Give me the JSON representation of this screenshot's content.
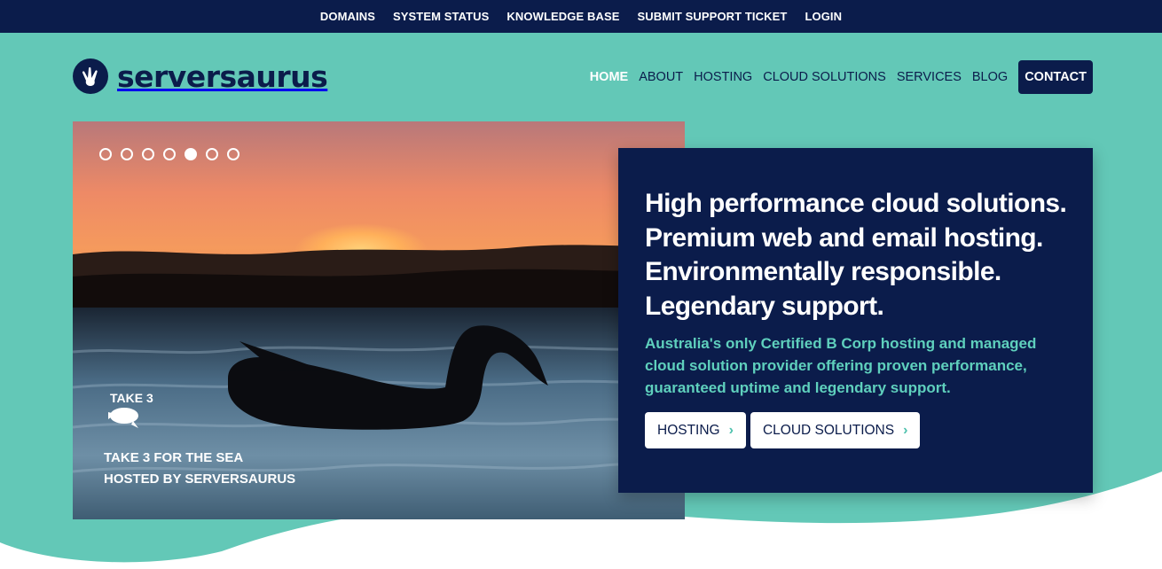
{
  "topnav": {
    "items": [
      "DOMAINS",
      "SYSTEM STATUS",
      "KNOWLEDGE BASE",
      "SUBMIT SUPPORT TICKET",
      "LOGIN"
    ]
  },
  "logo": {
    "text": "serversaurus",
    "icon": "dinosaur-footprint-icon"
  },
  "mainnav": {
    "home": "HOME",
    "about": "ABOUT",
    "hosting": "HOSTING",
    "cloud": "CLOUD SOLUTIONS",
    "services": "SERVICES",
    "blog": "BLOG",
    "contact": "CONTACT"
  },
  "slider": {
    "slide_count": 7,
    "active_index": 5,
    "badge": "TAKE 3",
    "caption_line1": "TAKE 3 FOR THE SEA",
    "caption_line2": "HOSTED BY SERVERSAURUS"
  },
  "panel": {
    "headline_lines": [
      "High performance cloud solutions.",
      "Premium web and email hosting.",
      "Environmentally responsible.",
      "Legendary support."
    ],
    "subtext": "Australia's only Certified B Corp hosting and managed cloud solution provider offering proven performance, guaranteed uptime and legendary support.",
    "buttons": {
      "hosting": "HOSTING",
      "cloud": "CLOUD SOLUTIONS"
    }
  },
  "colors": {
    "navy": "#0b1c4b",
    "teal": "#63c8b7",
    "accent": "#5fd0bd"
  }
}
